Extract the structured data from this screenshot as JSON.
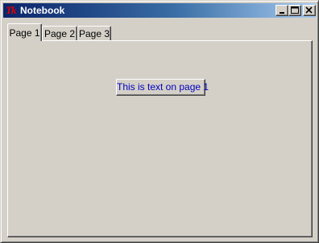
{
  "window": {
    "title": "Notebook",
    "app_icon": "tk-feather-icon",
    "app_icon_text": "Tk",
    "controls": {
      "minimize": "minimize-icon",
      "maximize": "maximize-icon",
      "close": "close-icon"
    }
  },
  "notebook": {
    "tabs": [
      {
        "label": "Page 1",
        "selected": true
      },
      {
        "label": "Page 2",
        "selected": false
      },
      {
        "label": "Page 3",
        "selected": false
      }
    ],
    "active_page": {
      "label_text": "This is text on page 1",
      "label_color": "#0000c0"
    }
  },
  "colors": {
    "face": "#d4d0c8",
    "titlebar_start": "#0a246a",
    "titlebar_end": "#a6caf0"
  }
}
